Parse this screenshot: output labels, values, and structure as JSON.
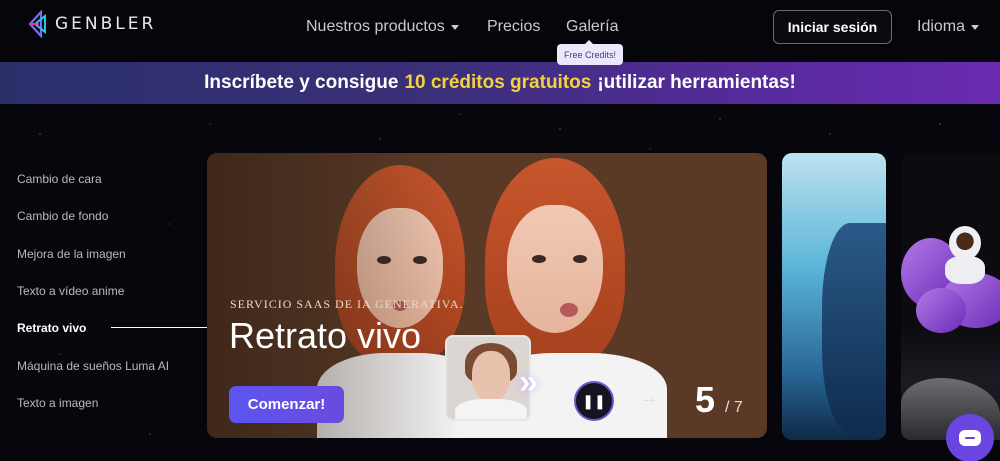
{
  "header": {
    "brand": "GENBLER",
    "nav": {
      "products": "Nuestros productos",
      "prices": "Precios",
      "gallery": "Galería"
    },
    "free_tag": "Free Credits!",
    "login": "Iniciar sesión",
    "language": "Idioma"
  },
  "banner": {
    "before": "Inscríbete y consigue",
    "highlight": "10 créditos gratuitos",
    "after": "¡utilizar herramientas!"
  },
  "sidebar": {
    "items": [
      {
        "label": "Cambio de cara"
      },
      {
        "label": "Cambio de fondo"
      },
      {
        "label": "Mejora de la imagen"
      },
      {
        "label": "Texto a vídeo anime"
      },
      {
        "label": "Retrato vivo"
      },
      {
        "label": "Máquina de sueños Luma AI"
      },
      {
        "label": "Texto a imagen"
      }
    ],
    "active_index": 4
  },
  "hero": {
    "subtitle": "SERVICIO SAAS DE IA GENERATIVA.",
    "title": "Retrato vivo",
    "cta": "Comenzar!",
    "counter_current": "5",
    "counter_total": "/ 7"
  },
  "icons": {
    "logo": "genbler-logo-icon",
    "pause": "pause-icon",
    "next": "arrow-right-icon",
    "chat": "chat-icon"
  },
  "colors": {
    "accent": "#5b55f0",
    "highlight": "#f4d23c",
    "card_bg": "#5a3a27"
  }
}
